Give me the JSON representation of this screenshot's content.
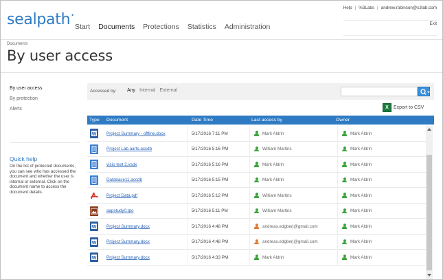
{
  "brand": {
    "name": "sealpath",
    "mark": "•"
  },
  "toplinks": {
    "help": "Help",
    "org": "%3Labs",
    "email": "andrew.robinson@s3lab.com",
    "exit": "Exit"
  },
  "nav": [
    {
      "label": "Start",
      "active": false
    },
    {
      "label": "Documents",
      "active": true
    },
    {
      "label": "Protections",
      "active": false
    },
    {
      "label": "Statistics",
      "active": false
    },
    {
      "label": "Administration",
      "active": false
    }
  ],
  "breadcrumb": "Documents",
  "page_title": "By user access",
  "sidebar": {
    "items": [
      {
        "label": "By user access",
        "selected": true
      },
      {
        "label": "By protection",
        "selected": false
      },
      {
        "label": "Alerts",
        "selected": false
      }
    ],
    "help_title": "Quick help",
    "help_text": "On the list of protected documents, you can see who has accessed the document and whether the user is internal or external. Click on the document name to access the document details."
  },
  "filter": {
    "label": "Accessed by:",
    "options": [
      {
        "label": "Any",
        "selected": true
      },
      {
        "label": "Internal",
        "selected": false
      },
      {
        "label": "External",
        "selected": false
      }
    ],
    "search_value": ""
  },
  "export_label": "Export to CSV",
  "table": {
    "headers": {
      "type": "Type",
      "document": "Document",
      "date": "Date Time",
      "last": "Last access by",
      "owner": "Owner"
    },
    "rows": [
      {
        "type": "word",
        "document": "Project Summary - offline.docx",
        "date": "5/17/2016 7:11 PM",
        "last": "Mark Aldrin",
        "last_kind": "green",
        "owner": "Mark Aldrin"
      },
      {
        "type": "doc",
        "document": "Project Lab.aarts.accdb",
        "date": "5/17/2016 5:16 PM",
        "last": "William Martins",
        "last_kind": "green",
        "owner": "Mark Aldrin"
      },
      {
        "type": "doc",
        "document": "visio test 2.vsdx",
        "date": "5/17/2016 5:16 PM",
        "last": "Mark Aldrin",
        "last_kind": "green",
        "owner": "Mark Aldrin"
      },
      {
        "type": "doc",
        "document": "Database11.accdb",
        "date": "5/17/2016 5:15 PM",
        "last": "Mark Aldrin",
        "last_kind": "green",
        "owner": "Mark Aldrin"
      },
      {
        "type": "pdf",
        "document": "Project Data.pdf",
        "date": "5/17/2016 5:12 PM",
        "last": "William Martins",
        "last_kind": "green",
        "owner": "Mark Aldrin"
      },
      {
        "type": "img",
        "document": "aapstudy0.tpo",
        "date": "5/17/2016 5:11 PM",
        "last": "William Martins",
        "last_kind": "green",
        "owner": "Mark Aldrin"
      },
      {
        "type": "word",
        "document": "Project Summary.docx",
        "date": "5/17/2016 4:48 PM",
        "last": "andreas.edgberj@gmail.com",
        "last_kind": "orange",
        "owner": "Mark Aldrin"
      },
      {
        "type": "word",
        "document": "Project Summary.docx",
        "date": "5/17/2016 4:48 PM",
        "last": "andreas.edgberj@gmail.com",
        "last_kind": "orange",
        "owner": "Mark Aldrin"
      },
      {
        "type": "word",
        "document": "Project Summary.docx",
        "date": "5/17/2016 4:33 PM",
        "last": "Mark Aldrin",
        "last_kind": "green",
        "owner": "Mark Aldrin"
      }
    ]
  },
  "colors": {
    "accent": "#2e7bc4",
    "internal_user": "#3aa53a",
    "external_user": "#e07b35"
  },
  "icons": {
    "search": "search-icon",
    "dropdown": "chevron-down-icon",
    "export": "excel-icon",
    "user": "user-icon"
  }
}
